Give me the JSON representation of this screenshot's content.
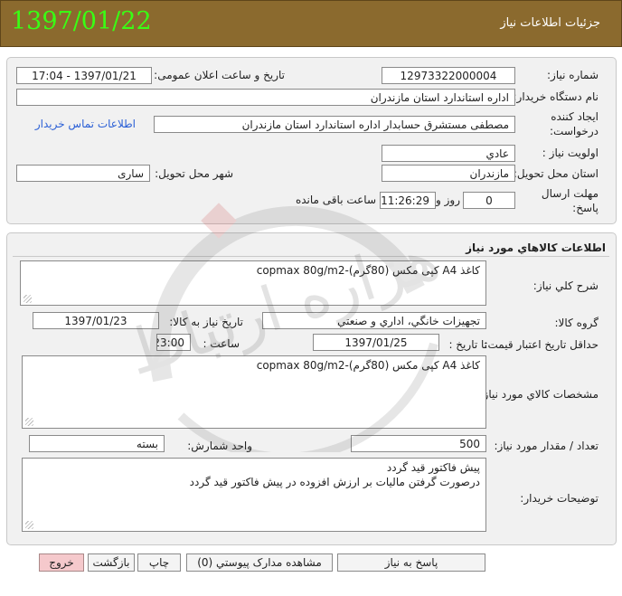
{
  "header": {
    "title": "جزئیات اطلاعات نیاز",
    "date_big": "1397/01/22"
  },
  "details": {
    "need_number_label": "شماره نیاز:",
    "need_number": "12973322000004",
    "announce_label": "تاریخ و ساعت اعلان عمومی:",
    "announce_value": "1397/01/21 - 17:04",
    "buyer_org_label": "نام دستگاه خریدار:",
    "buyer_org": "اداره استاندارد استان مازندران",
    "creator_label_1": "ایجاد کننده",
    "creator_label_2": "درخواست:",
    "creator": "مصطفی مستشرق حسابدار اداره استاندارد استان مازندران",
    "contact_link": "اطلاعات تماس خریدار",
    "priority_label": "اولویت نیاز :",
    "priority": "عادي",
    "province_label": "استان محل تحویل:",
    "province": "مازندران",
    "city_label": "شهر محل تحویل:",
    "city": "ساری",
    "deadline_label_1": "مهلت ارسال",
    "deadline_label_2": "پاسخ:",
    "days": "0",
    "days_suffix": "روز و",
    "time_left": "11:26:29",
    "time_left_suffix": "ساعت باقی مانده"
  },
  "goods": {
    "section_title": "اطلاعات کالاهاي مورد نياز",
    "summary_label": "شرح کلي نياز:",
    "summary": "کاغذ A4 کپی مکس (80گرم)-copmax 80g/m2",
    "group_label": "گروه کالا:",
    "group": "تجهيزات خانگي، اداري و صنعتي",
    "need_date_label": "تاريخ نياز به کالا:",
    "need_date": "1397/01/23",
    "validity_label": "حداقل تاريخ اعتبار قيمت:",
    "until_label": "تا تاريخ :",
    "until_date": "1397/01/25",
    "hour_label": "ساعت :",
    "hour": "23:00",
    "specs_label": "مشخصات کالاي مورد نياز:",
    "specs": "کاغذ A4 کپی مکس (80گرم)-copmax 80g/m2",
    "qty_label": "تعداد / مقدار مورد نياز:",
    "qty": "500",
    "unit_label": "واحد شمارش:",
    "unit": "بسته",
    "notes_label": "توضيحات خريدار:",
    "notes_line1": "پیش فاکتور قید گردد",
    "notes_line2": "درصورت گرفتن مالیات بر ارزش افزوده در پیش فاکتور قید گردد"
  },
  "buttons": {
    "reply": "پاسخ به نياز",
    "attachments": "مشاهده مدارک پيوستي (0)",
    "print": "چاپ",
    "back": "بازگشت",
    "exit": "خروج"
  },
  "colors": {
    "header_bg": "#8b6a2e",
    "header_date": "#39ff14",
    "link": "#2a5fd6",
    "exit_button": "#f5c9cc"
  },
  "watermark_text": "هزاره ارتباط"
}
